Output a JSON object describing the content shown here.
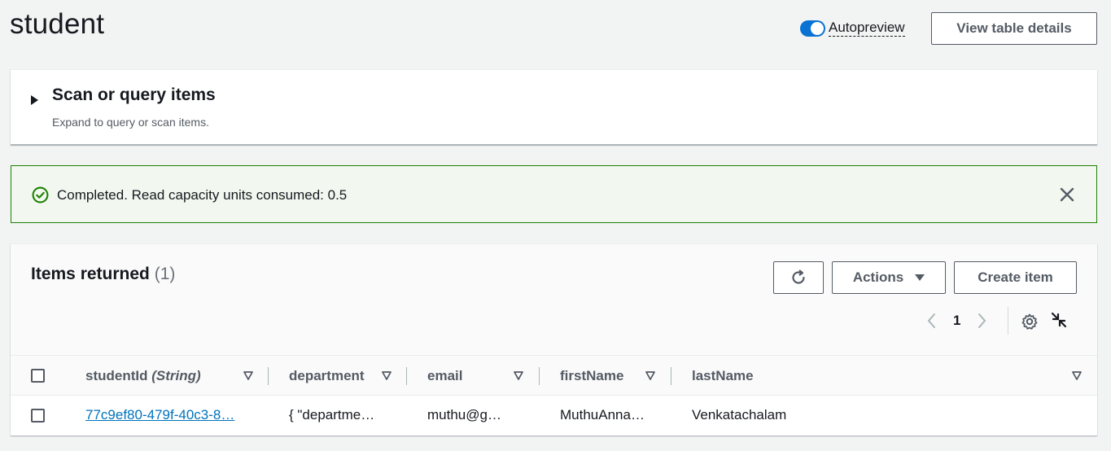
{
  "page": {
    "title": "student"
  },
  "autopreview": {
    "label": "Autopreview",
    "enabled": true
  },
  "view_table_button": "View table details",
  "scan_panel": {
    "title": "Scan or query items",
    "description": "Expand to query or scan items."
  },
  "flash": {
    "message": "Completed. Read capacity units consumed: 0.5",
    "color": "#1d8102"
  },
  "items": {
    "title": "Items returned",
    "count": "(1)",
    "actions_label": "Actions",
    "create_label": "Create item",
    "page_number": "1",
    "columns": [
      "studentId",
      "department",
      "email",
      "firstName",
      "lastName"
    ],
    "column_type": "(String)",
    "rows": [
      {
        "studentId": "77c9ef80-479f-40c3-8…",
        "department": "{ \"departme…",
        "email": "muthu@g…",
        "firstName": "MuthuAnna…",
        "lastName": "Venkatachalam"
      }
    ]
  },
  "accent_color": "#0972d3"
}
